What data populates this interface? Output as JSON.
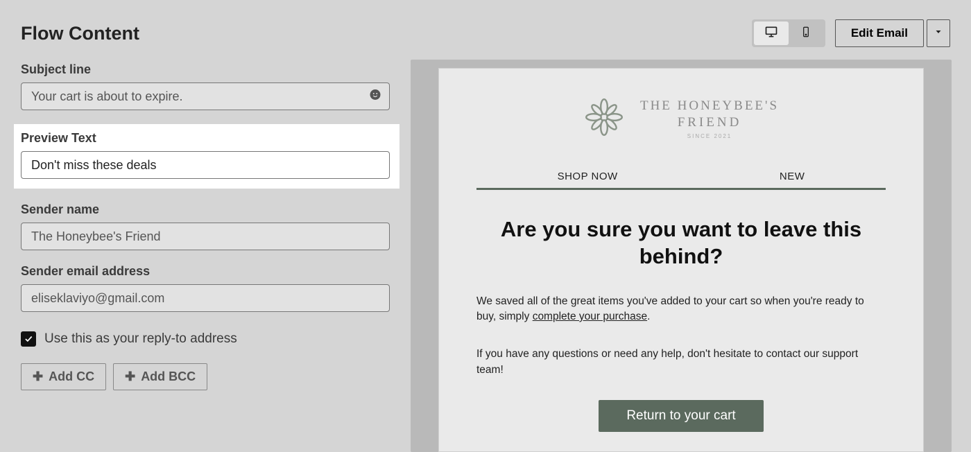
{
  "header": {
    "title": "Flow Content",
    "edit_label": "Edit Email"
  },
  "device": {
    "active": "desktop"
  },
  "form": {
    "subject": {
      "label": "Subject line",
      "value": "Your cart is about to expire."
    },
    "preview_text": {
      "label": "Preview Text",
      "value": "Don't miss these deals"
    },
    "sender_name": {
      "label": "Sender name",
      "value": "The Honeybee's Friend"
    },
    "sender_email": {
      "label": "Sender email address",
      "value": "eliseklaviyo@gmail.com"
    },
    "reply_to": {
      "checked": true,
      "label": "Use this as your reply-to address"
    },
    "add_cc_label": "Add CC",
    "add_bcc_label": "Add BCC"
  },
  "email_preview": {
    "brand_line1": "THE HONEYBEE'S",
    "brand_line2": "FRIEND",
    "brand_tagline": "SINCE 2021",
    "nav": [
      "SHOP NOW",
      "NEW"
    ],
    "headline": "Are you sure you want to leave this behind?",
    "body_1_a": "We saved all of the great items you've added to your cart so when you're ready to buy, simply ",
    "body_1_link": "complete your purchase",
    "body_1_b": ".",
    "body_2": "If you have any questions or need any help, don't hesitate to contact our support team!",
    "cta": "Return to your cart"
  },
  "colors": {
    "brand_green": "#5b6a5e"
  }
}
